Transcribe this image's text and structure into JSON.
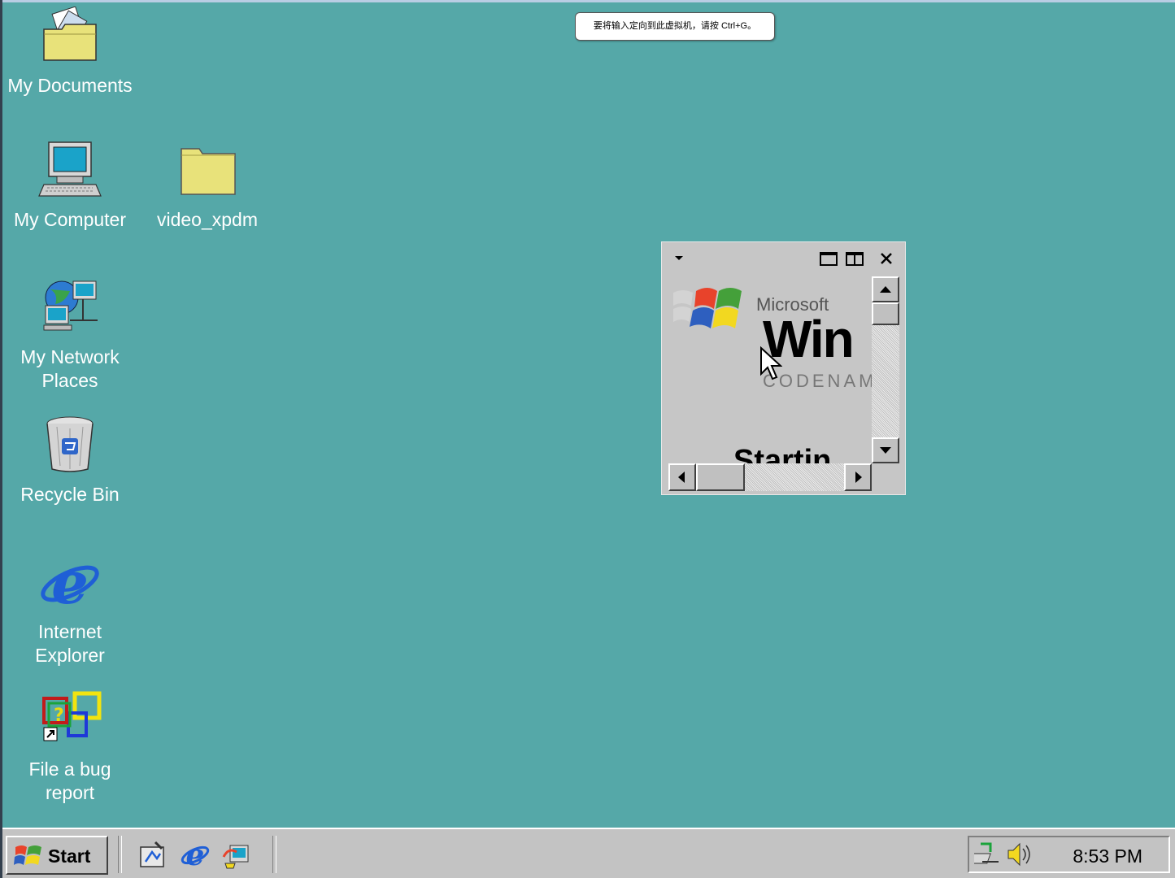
{
  "tooltip": {
    "text": "要将输入定向到此虚拟机，请按 Ctrl+G。"
  },
  "desktop": {
    "icons": [
      {
        "label": "My Documents",
        "icon": "my-documents-icon"
      },
      {
        "label": "My Computer",
        "icon": "my-computer-icon"
      },
      {
        "label": "video_xpdm",
        "icon": "folder-icon"
      },
      {
        "label": "My Network\nPlaces",
        "icon": "network-places-icon"
      },
      {
        "label": "Recycle Bin",
        "icon": "recycle-bin-icon"
      },
      {
        "label": "Internet\nExplorer",
        "icon": "internet-explorer-icon"
      },
      {
        "label": "File a bug\nreport",
        "icon": "file-bug-icon"
      }
    ]
  },
  "splash": {
    "brand": "Microsoft",
    "product": "Win",
    "codename": "CODENAME",
    "status": "Startin"
  },
  "taskbar": {
    "start_label": "Start",
    "quicklaunch": [
      "show-desktop-icon",
      "internet-explorer-icon",
      "windows-update-icon"
    ],
    "tray_icons": [
      "network-icon",
      "volume-icon"
    ],
    "clock": "8:53 PM"
  },
  "colors": {
    "desktop": "#55a8a8",
    "taskbar": "#c3c3c3"
  }
}
